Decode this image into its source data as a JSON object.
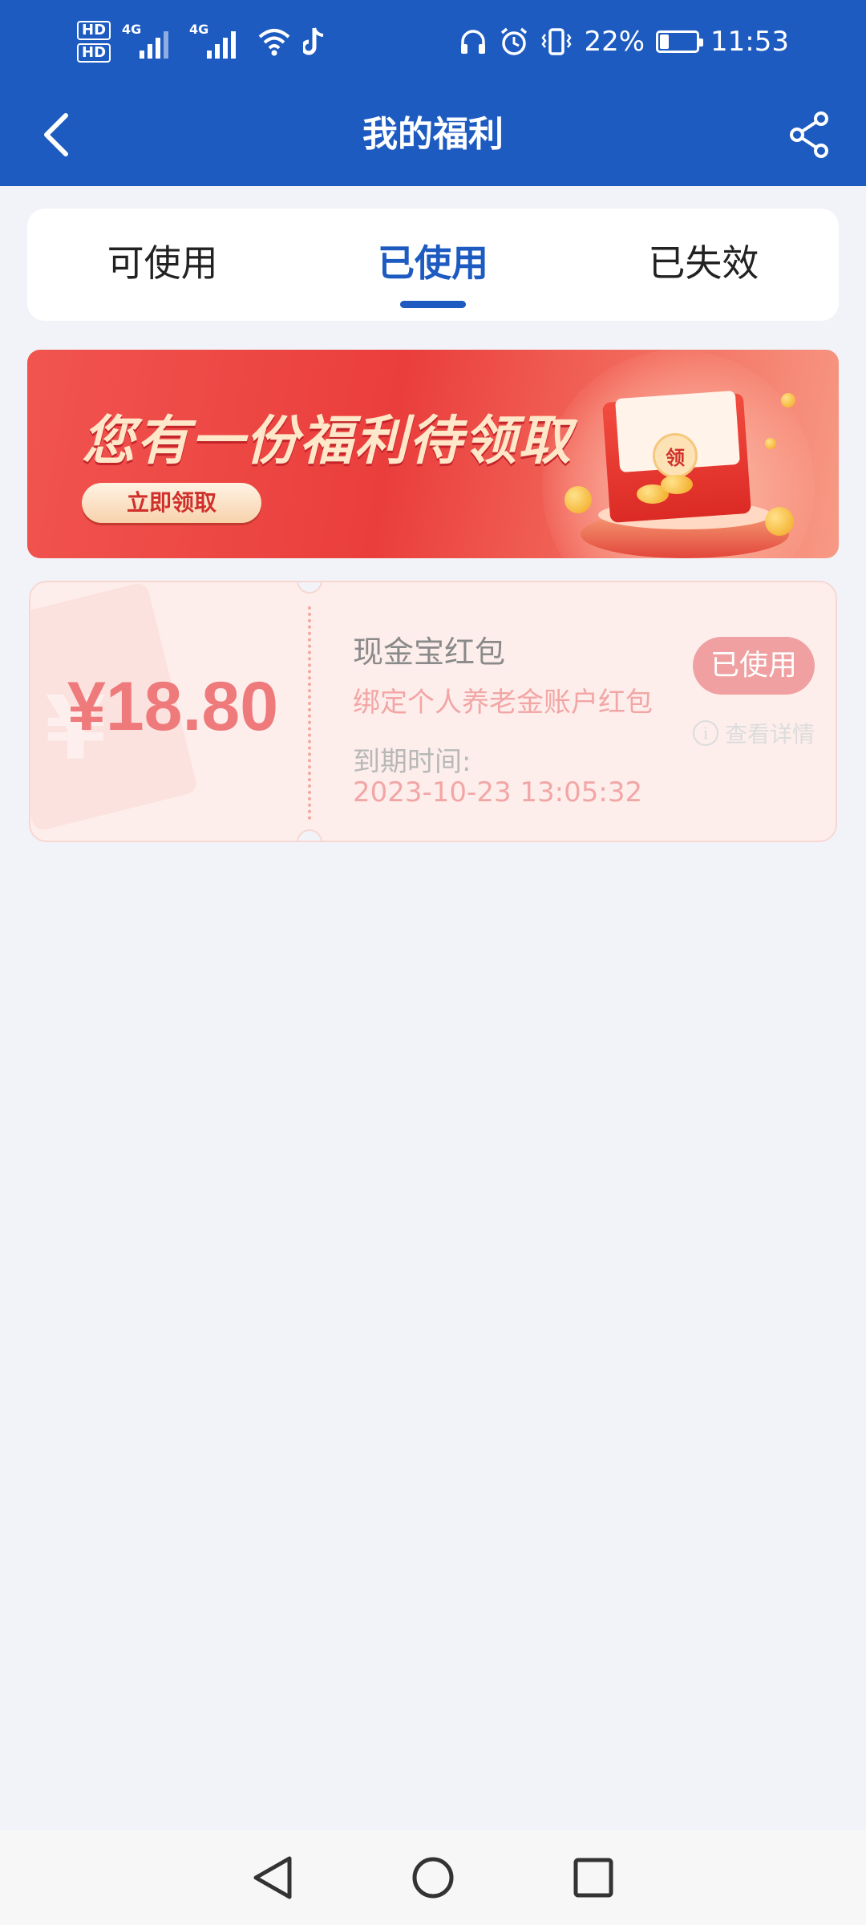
{
  "status_bar": {
    "hd1": "HD",
    "hd2": "HD",
    "net1": "4G",
    "net2": "4G",
    "battery": "22%",
    "time": "11:53",
    "icons": [
      "hd-icon",
      "signal-icon",
      "wifi-icon",
      "tiktok-icon",
      "headphones-icon",
      "alarm-icon",
      "vibrate-icon",
      "battery-icon"
    ]
  },
  "header": {
    "title": "我的福利",
    "back_icon": "chevron-left-icon",
    "share_icon": "share-icon"
  },
  "tabs": [
    {
      "label": "可使用",
      "active": false
    },
    {
      "label": "已使用",
      "active": true
    },
    {
      "label": "已失效",
      "active": false
    }
  ],
  "banner": {
    "title": "您有一份福利待领取",
    "button": "立即领取",
    "envelope_char": "领"
  },
  "coupon": {
    "amount": "¥18.80",
    "title": "现金宝红包",
    "subtitle": "绑定个人养老金账户红包",
    "expiry_label": "到期时间:",
    "expiry_value": "2023-10-23 13:05:32",
    "status": "已使用",
    "detail_link": "查看详情"
  },
  "colors": {
    "primary": "#1d5bc1",
    "background": "#f1f3f8",
    "coupon_bg": "#fdeeec",
    "coupon_accent": "#ef7a7b"
  }
}
